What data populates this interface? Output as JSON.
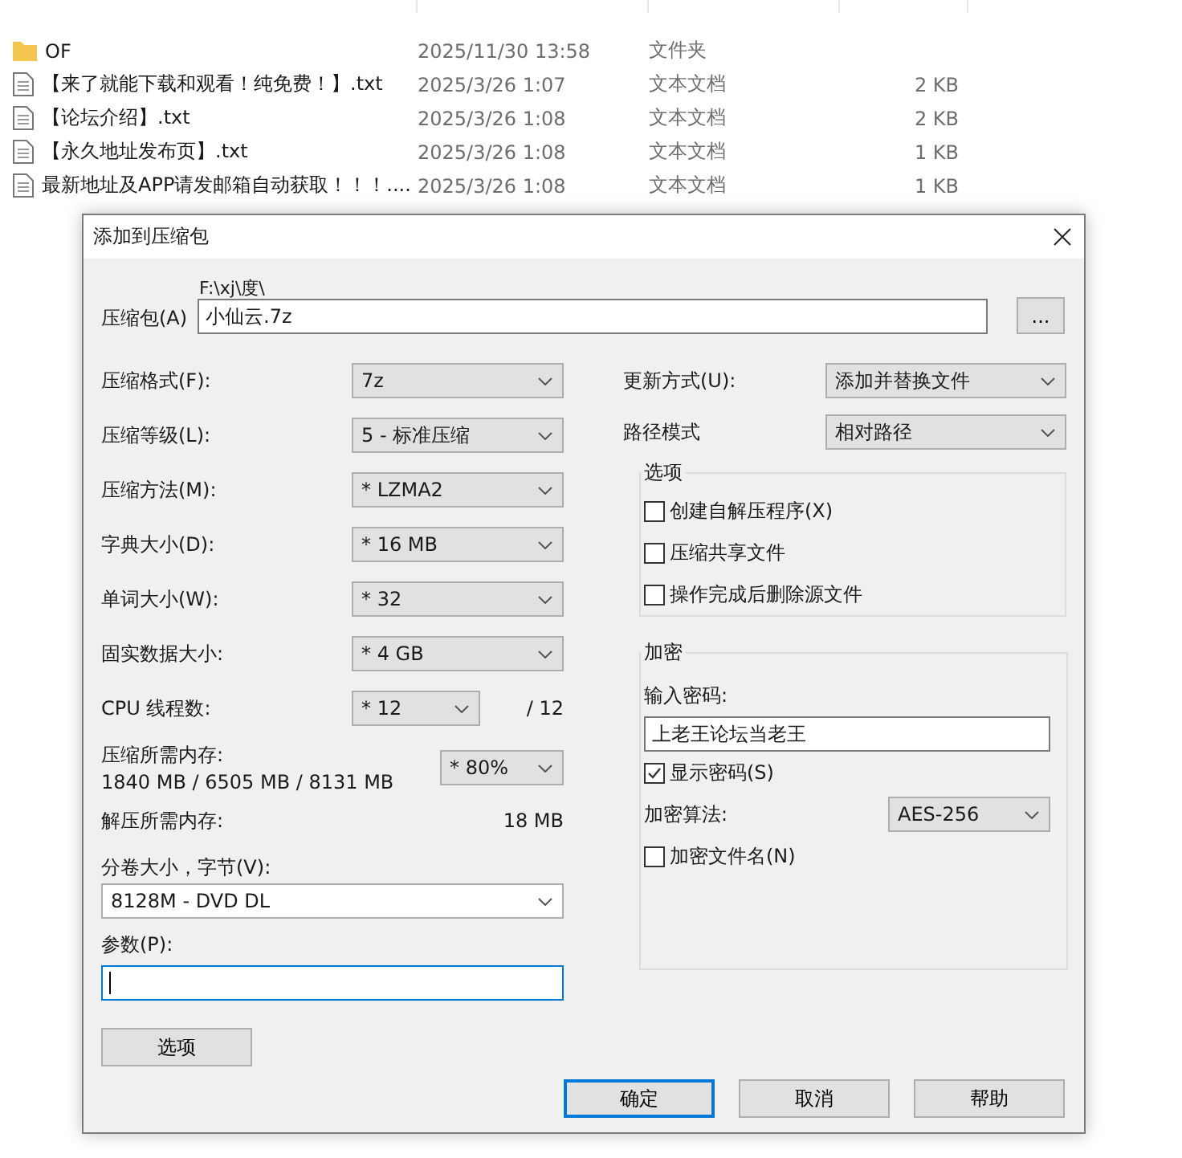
{
  "explorer": {
    "rows": [
      {
        "kind": "folder",
        "name": "OF",
        "date": "2025/11/30 13:58",
        "type": "文件夹",
        "size": ""
      },
      {
        "kind": "text",
        "name": "【来了就能下载和观看！纯免费！】.txt",
        "date": "2025/3/26 1:07",
        "type": "文本文档",
        "size": "2 KB"
      },
      {
        "kind": "text",
        "name": "【论坛介绍】.txt",
        "date": "2025/3/26 1:08",
        "type": "文本文档",
        "size": "2 KB"
      },
      {
        "kind": "text",
        "name": "【永久地址发布页】.txt",
        "date": "2025/3/26 1:08",
        "type": "文本文档",
        "size": "1 KB"
      },
      {
        "kind": "text",
        "name": "最新地址及APP请发邮箱自动获取！！！....",
        "date": "2025/3/26 1:08",
        "type": "文本文档",
        "size": "1 KB"
      }
    ]
  },
  "dialog": {
    "title": "添加到压缩包",
    "archive": {
      "label": "压缩包(A)",
      "path": "F:\\xj\\度\\",
      "value": "小仙云.7z",
      "browse": "..."
    },
    "left": [
      {
        "kind": "combo",
        "label": "压缩格式(F):",
        "value": "7z"
      },
      {
        "kind": "combo",
        "label": "压缩等级(L):",
        "value": "5 - 标准压缩"
      },
      {
        "kind": "combo",
        "label": "压缩方法(M):",
        "value": "*  LZMA2"
      },
      {
        "kind": "combo",
        "label": "字典大小(D):",
        "value": "*  16 MB"
      },
      {
        "kind": "combo",
        "label": "单词大小(W):",
        "value": "*  32"
      },
      {
        "kind": "combo",
        "label": "固实数据大小:",
        "value": "*  4 GB"
      },
      {
        "kind": "cpu",
        "label": "CPU 线程数:",
        "value": "*  12",
        "suffix": "/ 12"
      },
      {
        "kind": "memory",
        "label": "压缩所需内存:",
        "detail": "1840 MB / 6505 MB / 8131 MB",
        "value": "*  80%"
      },
      {
        "kind": "info",
        "label": "解压所需内存:",
        "value": "18 MB"
      },
      {
        "kind": "wide",
        "label": "分卷大小，字节(V):",
        "value": "8128M - DVD DL"
      },
      {
        "kind": "input",
        "label": "参数(P):"
      }
    ],
    "options_button": "选项",
    "update": {
      "label": "更新方式(U):",
      "value": "添加并替换文件"
    },
    "path_mode": {
      "label": "路径模式",
      "value": "相对路径"
    },
    "options_group": {
      "title": "选项",
      "checkboxes": [
        {
          "label": "创建自解压程序(X)",
          "checked": false
        },
        {
          "label": "压缩共享文件",
          "checked": false
        },
        {
          "label": "操作完成后删除源文件",
          "checked": false
        }
      ]
    },
    "encryption": {
      "title": "加密",
      "password_label": "输入密码:",
      "password": "上老王论坛当老王",
      "show_password": {
        "label": "显示密码(S)",
        "checked": true
      },
      "method_label": "加密算法:",
      "method": "AES-256",
      "encrypt_names": {
        "label": "加密文件名(N)",
        "checked": false
      }
    },
    "buttons": [
      {
        "label": "确定",
        "default": true
      },
      {
        "label": "取消",
        "default": false
      },
      {
        "label": "帮助",
        "default": false
      }
    ]
  }
}
